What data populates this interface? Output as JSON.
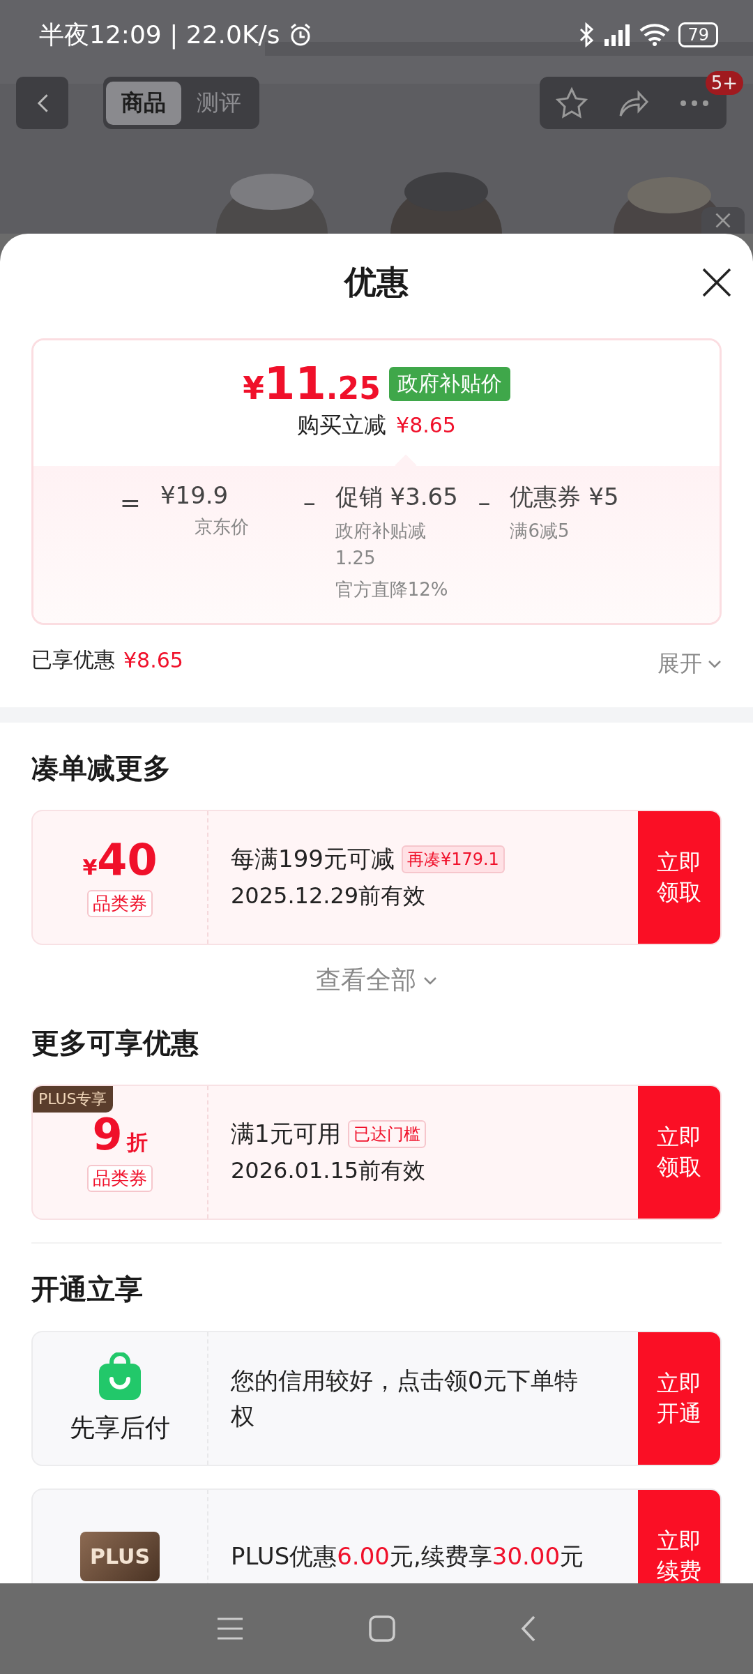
{
  "status_bar": {
    "time_speed": "半夜12:09 | 22.0K/s",
    "battery": "79"
  },
  "header": {
    "tabs": [
      {
        "label": "商品",
        "selected": true
      },
      {
        "label": "测评",
        "selected": false
      }
    ],
    "badge": "5+"
  },
  "sheet": {
    "title": "优惠"
  },
  "price_card": {
    "price_symbol": "¥",
    "price_main": "11",
    "price_decimal": ".25",
    "tag": "政府补贴价",
    "saving_label": "购买立减",
    "saving": "¥8.65",
    "breakdown": [
      {
        "kind": "operator",
        "text": "="
      },
      {
        "kind": "term",
        "value": "¥19.9",
        "notes": [
          "京东价"
        ]
      },
      {
        "kind": "operator",
        "text": "–"
      },
      {
        "kind": "term",
        "value": "促销 ¥3.65",
        "notes": [
          "政府补贴减1.25",
          "官方直降12%"
        ]
      },
      {
        "kind": "operator",
        "text": "–"
      },
      {
        "kind": "term",
        "value": "优惠券 ¥5",
        "notes": [
          "满6减5"
        ]
      }
    ]
  },
  "enjoyed": {
    "label": "已享优惠",
    "amount": "¥8.65",
    "expand": "展开"
  },
  "sections": [
    {
      "title": "凑单减更多",
      "coupons": [
        {
          "symbol": "¥",
          "amount": "40",
          "type_label": "品类券",
          "condition": "每满199元可减",
          "tag": "再凑¥179.1",
          "tag_filled": true,
          "validity": "2025.12.29前有效",
          "button": "立即领取"
        }
      ],
      "more": "查看全部"
    },
    {
      "title": "更多可享优惠",
      "coupons": [
        {
          "ribbon": "PLUS专享",
          "amount": "9",
          "unit": "折",
          "type_label": "品类券",
          "condition": "满1元可用",
          "tag": "已达门槛",
          "tag_filled": false,
          "validity": "2026.01.15前有效",
          "button": "立即领取"
        }
      ]
    }
  ],
  "services": {
    "title": "开通立享",
    "items": [
      {
        "kind": "bag",
        "name": "先享后付",
        "segments": [
          {
            "text": "您的信用较好，点击领0元下单特权",
            "highlight": false
          }
        ],
        "button": "立即开通"
      },
      {
        "kind": "plus",
        "logo_text": "PLUS",
        "segments": [
          {
            "text": "PLUS优惠",
            "highlight": false
          },
          {
            "text": "6.00",
            "highlight": true
          },
          {
            "text": "元,续费享",
            "highlight": false
          },
          {
            "text": "30.00",
            "highlight": true
          },
          {
            "text": "元",
            "highlight": false
          }
        ],
        "button": "立即续费"
      }
    ]
  }
}
